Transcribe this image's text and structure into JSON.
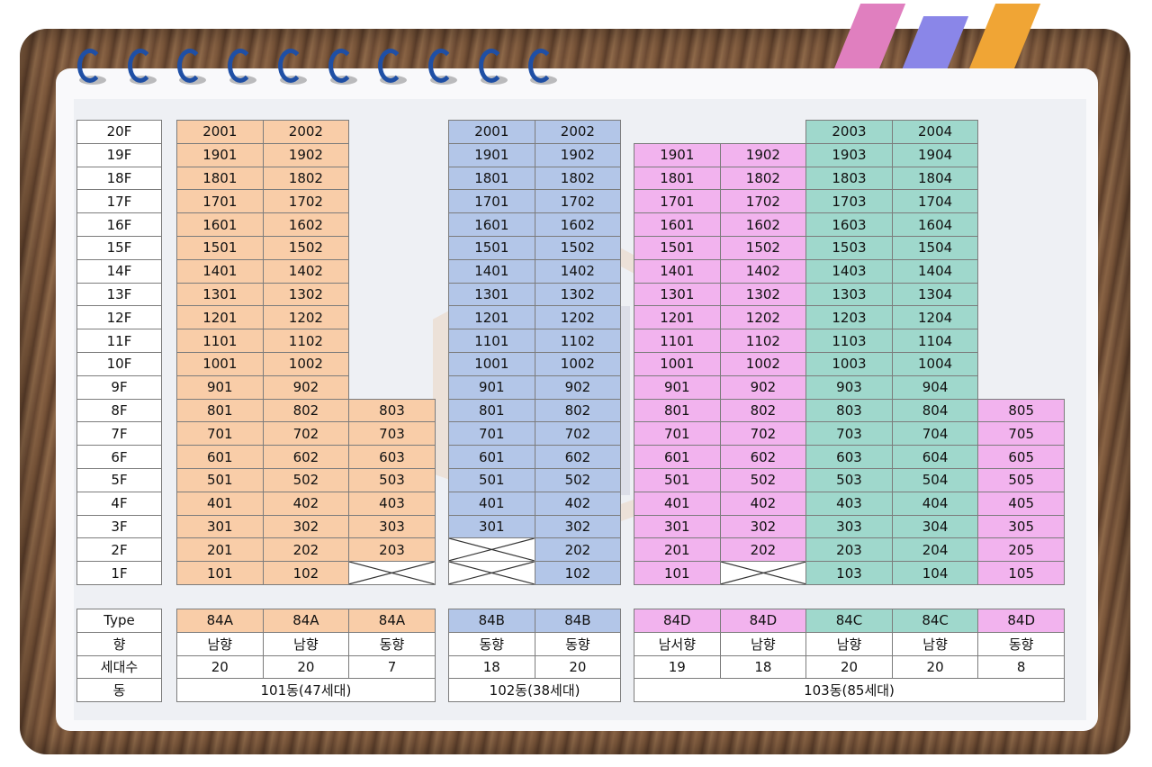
{
  "floors": [
    "20F",
    "19F",
    "18F",
    "17F",
    "16F",
    "15F",
    "14F",
    "13F",
    "12F",
    "11F",
    "10F",
    "9F",
    "8F",
    "7F",
    "6F",
    "5F",
    "4F",
    "3F",
    "2F",
    "1F"
  ],
  "columns": [
    {
      "group": "101",
      "color": "#f9cda8",
      "units": [
        "2001",
        "1901",
        "1801",
        "1701",
        "1601",
        "1501",
        "1401",
        "1301",
        "1201",
        "1101",
        "1001",
        "901",
        "801",
        "701",
        "601",
        "501",
        "401",
        "301",
        "201",
        "101"
      ]
    },
    {
      "group": "101",
      "color": "#f9cda8",
      "units": [
        "2002",
        "1902",
        "1802",
        "1702",
        "1602",
        "1502",
        "1402",
        "1302",
        "1202",
        "1102",
        "1002",
        "902",
        "802",
        "702",
        "602",
        "502",
        "402",
        "302",
        "202",
        "102"
      ]
    },
    {
      "group": "101",
      "color": "#f9cda8",
      "units": [
        null,
        null,
        null,
        null,
        null,
        null,
        null,
        null,
        null,
        null,
        null,
        null,
        "803",
        "703",
        "603",
        "503",
        "403",
        "303",
        "203",
        "X"
      ]
    },
    {
      "group": "102",
      "color": "#b3c6e8",
      "units": [
        "2001",
        "1901",
        "1801",
        "1701",
        "1601",
        "1501",
        "1401",
        "1301",
        "1201",
        "1101",
        "1001",
        "901",
        "801",
        "701",
        "601",
        "501",
        "401",
        "301",
        "X",
        "X"
      ]
    },
    {
      "group": "102",
      "color": "#b3c6e8",
      "units": [
        "2002",
        "1902",
        "1802",
        "1702",
        "1602",
        "1502",
        "1402",
        "1302",
        "1202",
        "1102",
        "1002",
        "902",
        "802",
        "702",
        "602",
        "502",
        "402",
        "302",
        "202",
        "102"
      ]
    },
    {
      "group": "103",
      "color": "#f2b3ee",
      "units": [
        null,
        "1901",
        "1801",
        "1701",
        "1601",
        "1501",
        "1401",
        "1301",
        "1201",
        "1101",
        "1001",
        "901",
        "801",
        "701",
        "601",
        "501",
        "401",
        "301",
        "201",
        "101"
      ]
    },
    {
      "group": "103",
      "color": "#f2b3ee",
      "units": [
        null,
        "1902",
        "1802",
        "1702",
        "1602",
        "1502",
        "1402",
        "1302",
        "1202",
        "1102",
        "1002",
        "902",
        "802",
        "702",
        "602",
        "502",
        "402",
        "302",
        "202",
        "X"
      ]
    },
    {
      "group": "103",
      "color": "#9fd8cc",
      "units": [
        "2003",
        "1903",
        "1803",
        "1703",
        "1603",
        "1503",
        "1403",
        "1303",
        "1203",
        "1103",
        "1003",
        "903",
        "803",
        "703",
        "603",
        "503",
        "403",
        "303",
        "203",
        "103"
      ]
    },
    {
      "group": "103",
      "color": "#9fd8cc",
      "units": [
        "2004",
        "1904",
        "1804",
        "1704",
        "1604",
        "1504",
        "1404",
        "1304",
        "1204",
        "1104",
        "1004",
        "904",
        "804",
        "704",
        "604",
        "504",
        "404",
        "304",
        "204",
        "104"
      ]
    },
    {
      "group": "103",
      "color": "#f2b3ee",
      "units": [
        null,
        null,
        null,
        null,
        null,
        null,
        null,
        null,
        null,
        null,
        null,
        null,
        "805",
        "705",
        "605",
        "505",
        "405",
        "305",
        "205",
        "105"
      ]
    }
  ],
  "summary": {
    "labels": [
      "Type",
      "향",
      "세대수",
      "동"
    ],
    "types": [
      "84A",
      "84A",
      "84A",
      "84B",
      "84B",
      "84D",
      "84D",
      "84C",
      "84C",
      "84D"
    ],
    "directions": [
      "남향",
      "남향",
      "동향",
      "동향",
      "동향",
      "남서향",
      "남향",
      "남향",
      "남향",
      "동향"
    ],
    "households": [
      "20",
      "20",
      "7",
      "18",
      "20",
      "19",
      "18",
      "20",
      "20",
      "8"
    ],
    "buildings": [
      {
        "label": "101동(47세대)",
        "span": 3
      },
      {
        "label": "102동(38세대)",
        "span": 2
      },
      {
        "label": "103동(85세대)",
        "span": 5
      }
    ]
  }
}
